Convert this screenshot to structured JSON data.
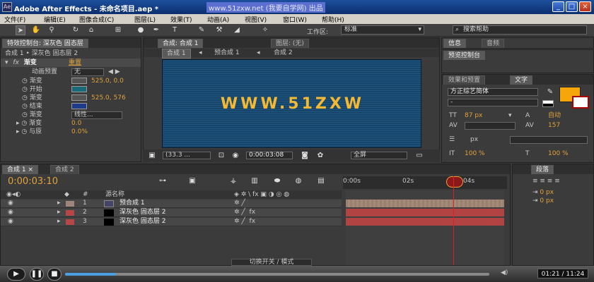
{
  "window": {
    "title": "Adobe After Effects - 未命名项目.aep *",
    "watermark": "www.51zxw.net (我要自学网) 出品",
    "app_icon": "Ae"
  },
  "menu": [
    "文件(F)",
    "编辑(E)",
    "图像合成(C)",
    "图层(L)",
    "效果(T)",
    "动画(A)",
    "视图(V)",
    "窗口(W)",
    "帮助(H)"
  ],
  "toolbar": {
    "workspace_label": "工作区:",
    "workspace_value": "标准",
    "search_placeholder": "搜索帮助"
  },
  "effect_panel": {
    "tab": "特效控制台: 深灰色 固态层",
    "layer_path": "合成 1 • 深灰色 固态层 2",
    "fx_name": "渐变",
    "reset": "重置",
    "rows": [
      {
        "label": "动画预置",
        "value": "无"
      },
      {
        "label": "渐变",
        "value": "525.0, 0.0"
      },
      {
        "label": "开始",
        "value": ""
      },
      {
        "label": "渐变",
        "value": "525.0, 576"
      },
      {
        "label": "结束",
        "value": ""
      },
      {
        "label": "渐变",
        "value": "线性..."
      },
      {
        "label": "渐变",
        "value": "0.0"
      },
      {
        "label": "与原",
        "value": "0.0%"
      }
    ]
  },
  "viewer": {
    "tab": "合成: 合成 1",
    "layer_tab": "图层: (无)",
    "breadcrumbs": [
      "合成 1",
      "预合成 1",
      "合成 2"
    ],
    "stage_text": "WWW.51ZXW",
    "zoom": "(33.3 ...",
    "timecode": "0:00:03:08",
    "resolution": "全屏"
  },
  "info_panel": {
    "tabs": [
      "信息",
      "音频"
    ],
    "preview_tab": "预览控制台",
    "effects_tab": "效果和预置",
    "text_tab": "文字",
    "font": "方正综艺简体",
    "font_style": "-",
    "size": "87 px",
    "leading": "自动",
    "kerning_value": "157",
    "stroke": "px",
    "scale_v": "100 %",
    "scale_h": "100 %"
  },
  "timeline": {
    "tabs": [
      "合成 1",
      "合成 2"
    ],
    "timecode": "0:00:03:10",
    "column_header": "源名称",
    "ruler": [
      "0:00s",
      "02s",
      "04s"
    ],
    "layers": [
      {
        "num": "1",
        "name": "预合成 1",
        "color": "#a0857a"
      },
      {
        "num": "2",
        "name": "深灰色 固态层 2",
        "color": "#b84646"
      },
      {
        "num": "3",
        "name": "深灰色 固态层 2",
        "color": "#b84646"
      }
    ],
    "switch_mode": "切换开关 / 模式"
  },
  "paragraph_panel": {
    "tab": "段落",
    "val1": "0 px",
    "val2": "0 px"
  },
  "player": {
    "time": "01:21 / 11:24",
    "progress": 0.12
  }
}
